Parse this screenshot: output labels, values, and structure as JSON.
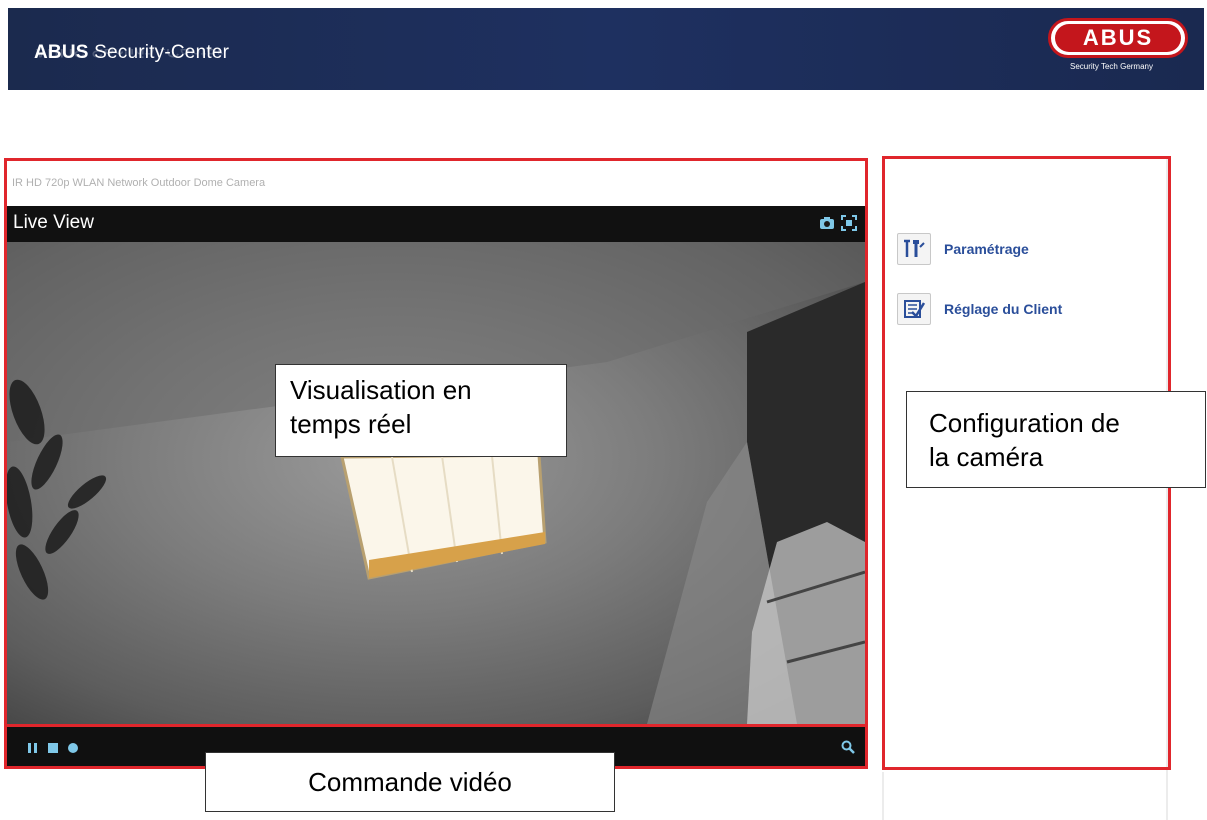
{
  "header": {
    "brand_bold": "ABUS",
    "brand_rest": " Security-Center",
    "logo_text": "ABUS",
    "logo_tagline": "Security Tech Germany"
  },
  "camera": {
    "name": "IR HD 720p WLAN Network Outdoor Dome Camera"
  },
  "liveview": {
    "title": "Live View",
    "icons": [
      "snapshot-icon",
      "fullscreen-icon"
    ]
  },
  "controls": {
    "icons": [
      "pause-icon",
      "stop-icon",
      "record-icon",
      "zoom-icon"
    ]
  },
  "menu": {
    "items": [
      {
        "label": "Paramétrage",
        "icon": "settings-tools-icon"
      },
      {
        "label": "Réglage du Client",
        "icon": "client-settings-icon"
      }
    ]
  },
  "callouts": {
    "live_view_line1": "Visualisation en",
    "live_view_line2": "temps réel",
    "config_line1": "Configuration de",
    "config_line2": "la caméra",
    "video_control": "Commande vidéo"
  },
  "colors": {
    "header_bg": "#1e3060",
    "highlight_red": "#e0262c",
    "logo_red": "#c4161c",
    "menu_link": "#2a4e9a",
    "control_accent": "#7fc8e8"
  }
}
